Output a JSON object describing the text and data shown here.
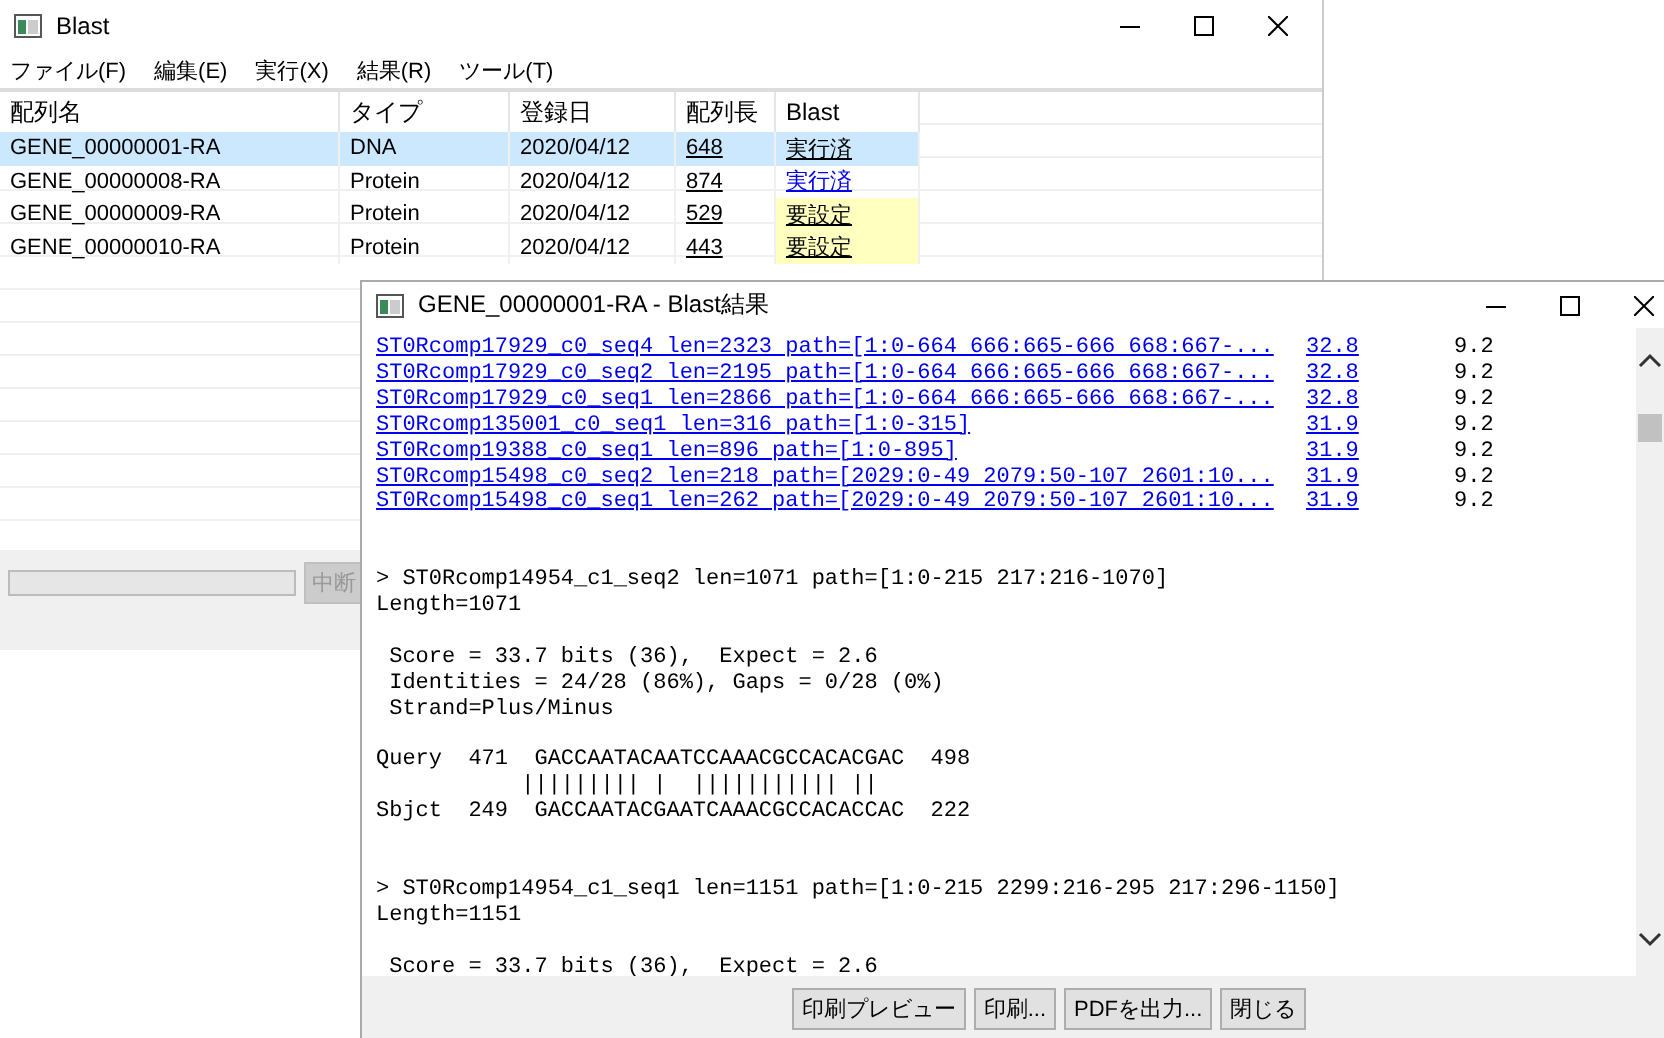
{
  "main_window": {
    "title": "Blast",
    "menu": [
      "ファイル(F)",
      "編集(E)",
      "実行(X)",
      "結果(R)",
      "ツール(T)"
    ],
    "table": {
      "columns": [
        "配列名",
        "タイプ",
        "登録日",
        "配列長",
        "Blast"
      ],
      "rows": [
        {
          "name": "GENE_00000001-RA",
          "type": "DNA",
          "date": "2020/04/12",
          "length": "648",
          "blast": {
            "kind": "done",
            "label": "実行済"
          },
          "selected": true
        },
        {
          "name": "GENE_00000008-RA",
          "type": "Protein",
          "date": "2020/04/12",
          "length": "874",
          "blast": {
            "kind": "done",
            "label": "実行済"
          },
          "selected": false
        },
        {
          "name": "GENE_00000009-RA",
          "type": "Protein",
          "date": "2020/04/12",
          "length": "529",
          "blast": {
            "kind": "setup",
            "label": "要設定"
          },
          "selected": false
        },
        {
          "name": "GENE_00000010-RA",
          "type": "Protein",
          "date": "2020/04/12",
          "length": "443",
          "blast": {
            "kind": "setup",
            "label": "要設定"
          },
          "selected": false
        }
      ]
    },
    "progress": {
      "level": 0
    },
    "abort_button": {
      "label": "中断",
      "disabled": true
    }
  },
  "result_window": {
    "title": "GENE_00000001-RA - Blast結果",
    "hits": [
      {
        "name": "ST0Rcomp17929_c0_seq4 len=2323 path=[1:0-664 666:665-666 668:667-...",
        "score": "32.8",
        "evalue": "9.2"
      },
      {
        "name": "ST0Rcomp17929_c0_seq2 len=2195 path=[1:0-664 666:665-666 668:667-...",
        "score": "32.8",
        "evalue": "9.2"
      },
      {
        "name": "ST0Rcomp17929_c0_seq1 len=2866 path=[1:0-664 666:665-666 668:667-...",
        "score": "32.8",
        "evalue": "9.2"
      },
      {
        "name": "ST0Rcomp135001_c0_seq1 len=316 path=[1:0-315]",
        "score": "31.9",
        "evalue": "9.2"
      },
      {
        "name": "ST0Rcomp19388_c0_seq1 len=896 path=[1:0-895]",
        "score": "31.9",
        "evalue": "9.2"
      },
      {
        "name": "ST0Rcomp15498_c0_seq2 len=218 path=[2029:0-49 2079:50-107 2601:10...",
        "score": "31.9",
        "evalue": "9.2"
      },
      {
        "name": "ST0Rcomp15498_c0_seq1 len=262 path=[2029:0-49 2079:50-107 2601:10...",
        "score": "31.9",
        "evalue": "9.2"
      }
    ],
    "alignments": [
      {
        "header": "> ST0Rcomp14954_c1_seq2 len=1071 path=[1:0-215 217:216-1070]",
        "length": "Length=1071",
        "stats": [
          "Score = 33.7 bits (36),  Expect = 2.6",
          "Identities = 24/28 (86%), Gaps = 0/28 (0%)",
          "Strand=Plus/Minus"
        ],
        "rows": [
          "Query  471  GACCAATACAATCCAAACGCCACACGAC  498",
          "           ||||||||| |  ||||||||||| ||",
          "Sbjct  249  GACCAATACGAATCAAACGCCACACCAC  222"
        ]
      },
      {
        "header": "> ST0Rcomp14954_c1_seq1 len=1151 path=[1:0-215 2299:216-295 217:296-1150]",
        "length": "Length=1151",
        "stats": [
          "Score = 33.7 bits (36),  Expect = 2.6"
        ]
      }
    ],
    "buttons": [
      "印刷プレビュー",
      "印刷...",
      "PDFを出力...",
      "閉じる"
    ]
  }
}
